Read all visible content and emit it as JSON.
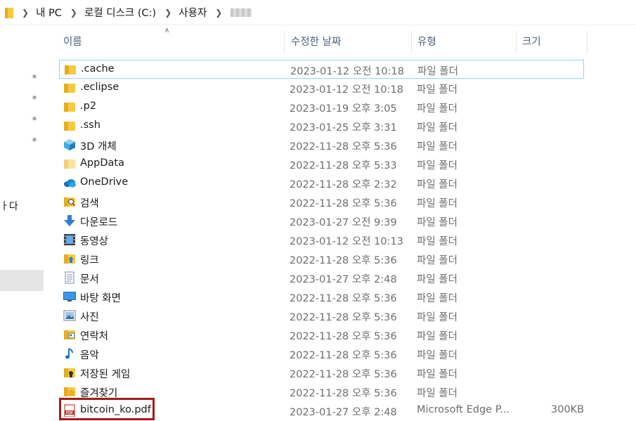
{
  "address": {
    "crumbs": [
      "내 PC",
      "로컬 디스크 (C:)",
      "사용자"
    ]
  },
  "nav": {
    "partial_label": "ㅏ다"
  },
  "columns": {
    "name": "이름",
    "date": "수정한 날짜",
    "type": "유형",
    "size": "크기"
  },
  "files": [
    {
      "name": ".cache",
      "date": "2023-01-12 오전 10:18",
      "type": "파일 폴더",
      "size": "",
      "icon": "folder-icon"
    },
    {
      "name": ".eclipse",
      "date": "2023-01-12 오전 10:18",
      "type": "파일 폴더",
      "size": "",
      "icon": "folder-icon"
    },
    {
      "name": ".p2",
      "date": "2023-01-19 오후 3:05",
      "type": "파일 폴더",
      "size": "",
      "icon": "folder-icon"
    },
    {
      "name": ".ssh",
      "date": "2023-01-25 오후 3:31",
      "type": "파일 폴더",
      "size": "",
      "icon": "folder-icon"
    },
    {
      "name": "3D 개체",
      "date": "2022-11-28 오후 5:36",
      "type": "파일 폴더",
      "size": "",
      "icon": "3d-objects-icon"
    },
    {
      "name": "AppData",
      "date": "2022-11-28 오후 5:33",
      "type": "파일 폴더",
      "size": "",
      "icon": "folder-light-icon"
    },
    {
      "name": "OneDrive",
      "date": "2022-11-28 오후 2:32",
      "type": "파일 폴더",
      "size": "",
      "icon": "onedrive-icon"
    },
    {
      "name": "검색",
      "date": "2022-11-28 오후 5:36",
      "type": "파일 폴더",
      "size": "",
      "icon": "search-folder-icon"
    },
    {
      "name": "다운로드",
      "date": "2023-01-27 오전 9:39",
      "type": "파일 폴더",
      "size": "",
      "icon": "download-icon"
    },
    {
      "name": "동영상",
      "date": "2023-01-12 오전 10:13",
      "type": "파일 폴더",
      "size": "",
      "icon": "video-icon"
    },
    {
      "name": "링크",
      "date": "2022-11-28 오후 5:36",
      "type": "파일 폴더",
      "size": "",
      "icon": "links-icon"
    },
    {
      "name": "문서",
      "date": "2023-01-27 오후 2:48",
      "type": "파일 폴더",
      "size": "",
      "icon": "documents-icon"
    },
    {
      "name": "바탕 화면",
      "date": "2022-11-28 오후 5:36",
      "type": "파일 폴더",
      "size": "",
      "icon": "desktop-icon"
    },
    {
      "name": "사진",
      "date": "2022-11-28 오후 5:36",
      "type": "파일 폴더",
      "size": "",
      "icon": "pictures-icon"
    },
    {
      "name": "연락처",
      "date": "2022-11-28 오후 5:36",
      "type": "파일 폴더",
      "size": "",
      "icon": "contacts-icon"
    },
    {
      "name": "음악",
      "date": "2022-11-28 오후 5:36",
      "type": "파일 폴더",
      "size": "",
      "icon": "music-icon"
    },
    {
      "name": "저장된 게임",
      "date": "2022-11-28 오후 5:36",
      "type": "파일 폴더",
      "size": "",
      "icon": "saved-games-icon"
    },
    {
      "name": "즐겨찾기",
      "date": "2022-11-28 오후 5:36",
      "type": "파일 폴더",
      "size": "",
      "icon": "favorites-icon"
    },
    {
      "name": "bitcoin_ko.pdf",
      "date": "2023-01-27 오후 2:48",
      "type": "Microsoft Edge P...",
      "size": "300KB",
      "icon": "pdf-icon"
    }
  ],
  "colors": {
    "folder": "#f8c93f",
    "selection_border": "#99d1ff",
    "highlight_box": "#a31a1a"
  }
}
